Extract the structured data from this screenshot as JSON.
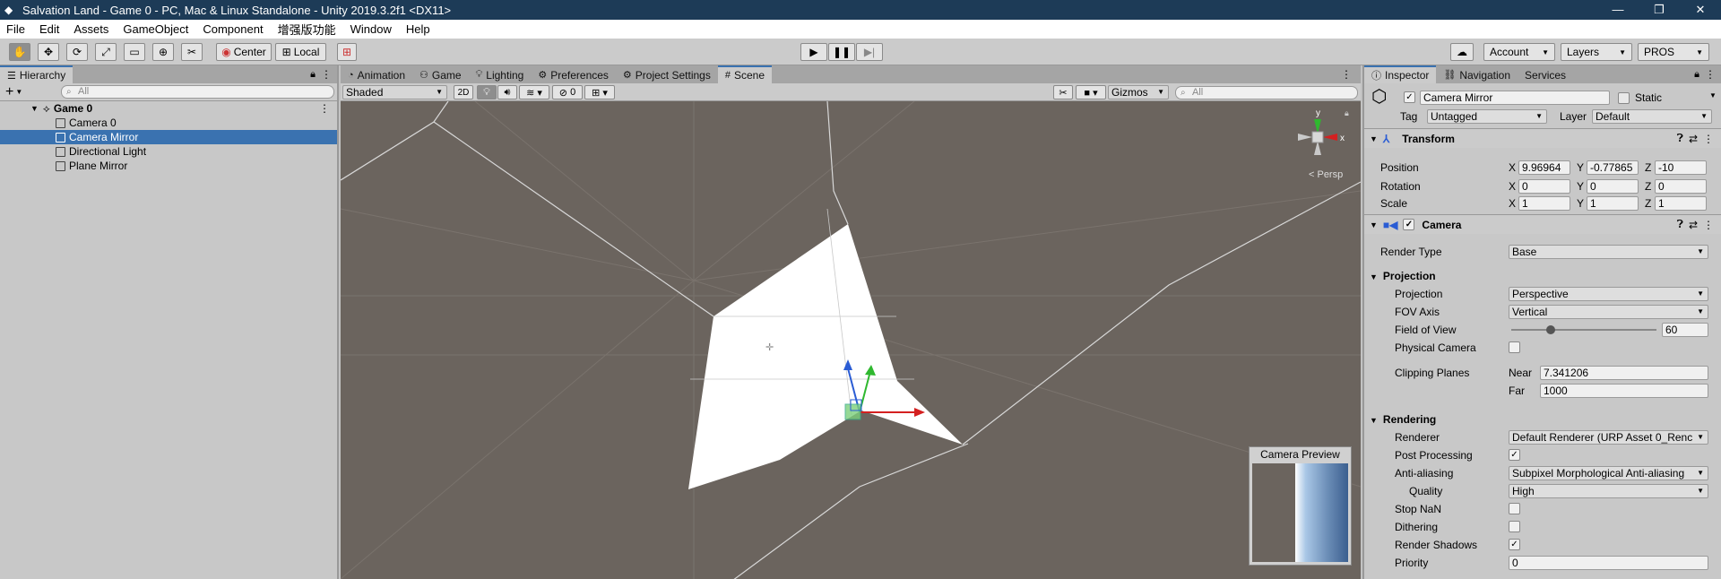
{
  "window": {
    "title": "Salvation Land - Game 0 - PC, Mac & Linux Standalone - Unity 2019.3.2f1 <DX11>",
    "minimize": "—",
    "restore": "❐",
    "close": "✕"
  },
  "menu": [
    "File",
    "Edit",
    "Assets",
    "GameObject",
    "Component",
    "增强版功能",
    "Window",
    "Help"
  ],
  "toolbar": {
    "pivot": "Center",
    "space": "Local",
    "account": "Account",
    "layers": "Layers",
    "layout": "PROS"
  },
  "hierarchy": {
    "tab": "Hierarchy",
    "search_placeholder": "All",
    "add": "+",
    "scene": "Game 0",
    "items": [
      "Camera 0",
      "Camera Mirror",
      "Directional Light",
      "Plane Mirror"
    ]
  },
  "scene_tabs": [
    "Animation",
    "Game",
    "Lighting",
    "Preferences",
    "Project Settings",
    "Scene"
  ],
  "scene_bar": {
    "shading": "Shaded",
    "mode2d": "2D",
    "hidden_count": "0",
    "gizmos": "Gizmos",
    "search_placeholder": "All"
  },
  "gizmo": {
    "y": "y",
    "x": "x",
    "persp": "< Persp"
  },
  "camera_preview": {
    "title": "Camera Preview"
  },
  "inspector": {
    "tabs": [
      "Inspector",
      "Navigation",
      "Services"
    ],
    "object_name": "Camera Mirror",
    "static": "Static",
    "tag_label": "Tag",
    "tag": "Untagged",
    "layer_label": "Layer",
    "layer": "Default",
    "transform": {
      "title": "Transform",
      "position_label": "Position",
      "rotation_label": "Rotation",
      "scale_label": "Scale",
      "position": [
        "9.96964",
        "-0.77865",
        "-10"
      ],
      "rotation": [
        "0",
        "0",
        "0"
      ],
      "scale": [
        "1",
        "1",
        "1"
      ],
      "axis": [
        "X",
        "Y",
        "Z"
      ]
    },
    "camera": {
      "title": "Camera",
      "render_type_label": "Render Type",
      "render_type": "Base",
      "projection_section": "Projection",
      "projection_label": "Projection",
      "projection": "Perspective",
      "fov_axis_label": "FOV Axis",
      "fov_axis": "Vertical",
      "fov_label": "Field of View",
      "fov": "60",
      "fov_fraction": 0.27,
      "physical_label": "Physical Camera",
      "clipping_label": "Clipping Planes",
      "near_label": "Near",
      "near": "7.341206",
      "far_label": "Far",
      "far": "1000",
      "rendering_section": "Rendering",
      "renderer_label": "Renderer",
      "renderer": "Default Renderer (URP Asset 0_Renc",
      "post_label": "Post Processing",
      "aa_label": "Anti-aliasing",
      "aa": "Subpixel Morphological Anti-aliasing",
      "quality_label": "Quality",
      "quality": "High",
      "stopnan_label": "Stop NaN",
      "dither_label": "Dithering",
      "shadows_label": "Render Shadows",
      "priority_label": "Priority",
      "priority": "0"
    }
  },
  "colors": {
    "title_bar": "#1d3b57",
    "selection": "#3a72b0",
    "scene_bg": "#6b645e"
  }
}
